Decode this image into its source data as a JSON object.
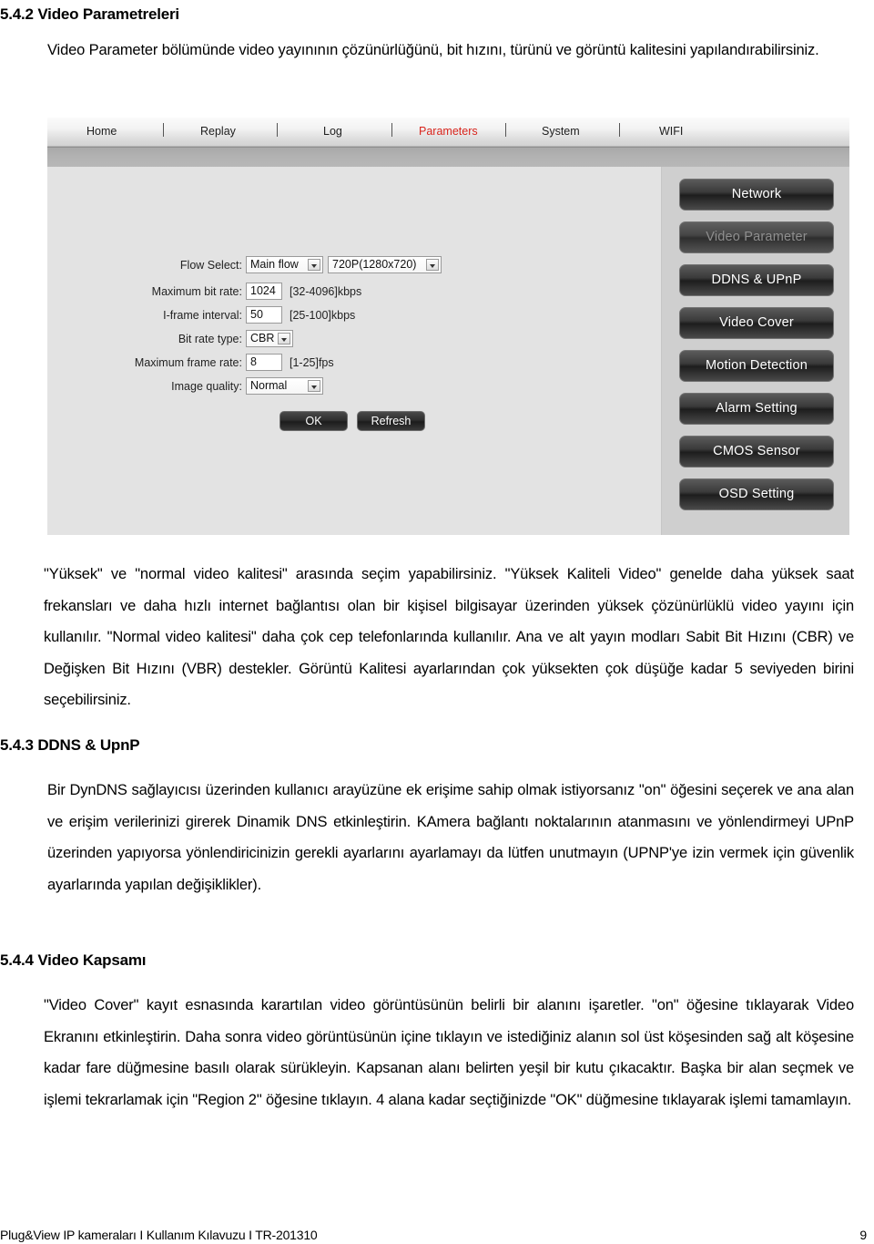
{
  "section_542": {
    "heading": "5.4.2 Video Parametreleri",
    "intro": "Video Parameter bölümünde video yayınının çözünürlüğünü, bit hızını, türünü ve görüntü kalitesini yapılandırabilirsiniz."
  },
  "screenshot": {
    "nav": [
      {
        "label": "Home",
        "active": false
      },
      {
        "label": "Replay",
        "active": false
      },
      {
        "label": "Log",
        "active": false
      },
      {
        "label": "Parameters",
        "active": true
      },
      {
        "label": "System",
        "active": false
      },
      {
        "label": "WIFI",
        "active": false
      }
    ],
    "form": {
      "flow_select_label": "Flow Select:",
      "flow_select_value": "Main flow",
      "resolution_value": "720P(1280x720)",
      "max_bitrate_label": "Maximum bit rate:",
      "max_bitrate_value": "1024",
      "max_bitrate_hint": "[32-4096]kbps",
      "iframe_label": "I-frame interval:",
      "iframe_value": "50",
      "iframe_hint": "[25-100]kbps",
      "bitrate_type_label": "Bit rate type:",
      "bitrate_type_value": "CBR",
      "max_framerate_label": "Maximum frame rate:",
      "max_framerate_value": "8",
      "max_framerate_hint": "[1-25]fps",
      "image_quality_label": "Image quality:",
      "image_quality_value": "Normal",
      "ok_label": "OK",
      "refresh_label": "Refresh"
    },
    "side_buttons": [
      {
        "label": "Network",
        "disabled": false
      },
      {
        "label": "Video Parameter",
        "disabled": true
      },
      {
        "label": "DDNS & UPnP",
        "disabled": false
      },
      {
        "label": "Video Cover",
        "disabled": false
      },
      {
        "label": "Motion Detection",
        "disabled": false
      },
      {
        "label": "Alarm Setting",
        "disabled": false
      },
      {
        "label": "CMOS Sensor",
        "disabled": false
      },
      {
        "label": "OSD Setting",
        "disabled": false
      }
    ],
    "accent_red": "#d9251d"
  },
  "body_para_1": "\"Yüksek\" ve \"normal video kalitesi\" arasında seçim yapabilirsiniz. \"Yüksek Kaliteli Video\" genelde daha yüksek saat frekansları ve daha hızlı internet bağlantısı olan bir kişisel bilgisayar üzerinden yüksek çözünürlüklü video yayını için kullanılır. \"Normal video kalitesi\" daha çok cep telefonlarında kullanılır. Ana ve alt yayın modları Sabit Bit Hızını (CBR) ve Değişken Bit Hızını (VBR) destekler. Görüntü Kalitesi ayarlarından çok yüksekten çok düşüğe kadar 5 seviyeden birini seçebilirsiniz.",
  "section_543": {
    "heading": "5.4.3 DDNS & UpnP",
    "body": "Bir DynDNS sağlayıcısı üzerinden kullanıcı arayüzüne ek erişime sahip olmak istiyorsanız \"on\" öğesini seçerek ve ana alan ve erişim verilerinizi girerek Dinamik DNS etkinleştirin. KAmera bağlantı noktalarının atanmasını ve yönlendirmeyi UPnP üzerinden yapıyorsa yönlendiricinizin gerekli ayarlarını ayarlamayı da lütfen unutmayın (UPNP'ye izin vermek için güvenlik ayarlarında yapılan değişiklikler)."
  },
  "section_544": {
    "heading": "5.4.4 Video Kapsamı",
    "body": "\"Video Cover\" kayıt esnasında karartılan video görüntüsünün belirli bir alanını işaretler. \"on\" öğesine tıklayarak Video Ekranını etkinleştirin. Daha sonra video görüntüsünün içine tıklayın ve istediğiniz alanın sol üst köşesinden sağ alt köşesine kadar fare düğmesine basılı olarak sürükleyin. Kapsanan alanı belirten yeşil bir kutu çıkacaktır. Başka bir alan seçmek ve işlemi tekrarlamak için \"Region 2\" öğesine tıklayın. 4 alana kadar seçtiğinizde \"OK\" düğmesine tıklayarak işlemi tamamlayın."
  },
  "footer": {
    "left": "Plug&View IP kameraları I Kullanım Kılavuzu I TR-201310",
    "page": "9"
  }
}
